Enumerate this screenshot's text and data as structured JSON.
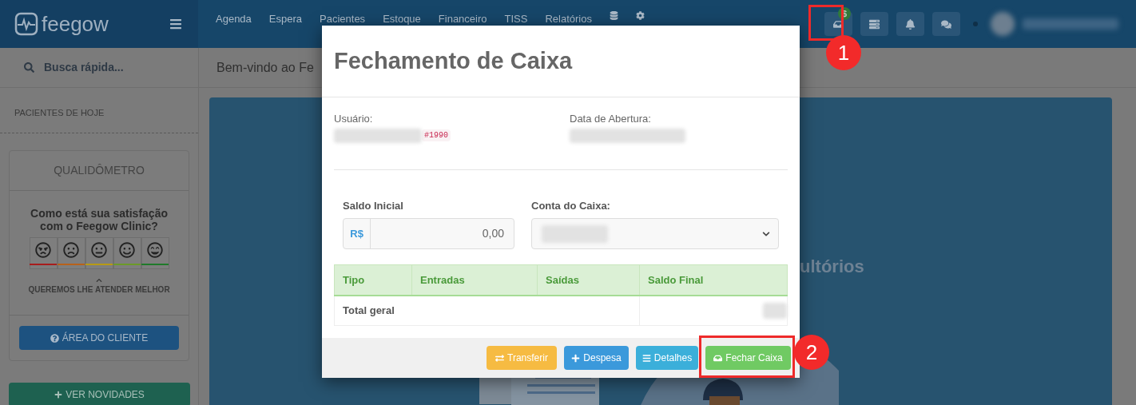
{
  "header": {
    "brand": "feegow",
    "nav": [
      "Agenda",
      "Espera",
      "Pacientes",
      "Estoque",
      "Financeiro",
      "TISS",
      "Relatórios"
    ],
    "cash_badge": "$"
  },
  "sidebar": {
    "search": "Busca rápida...",
    "section": "PACIENTES DE HOJE",
    "qualimeter": {
      "title": "QUALIDÔMETRO",
      "question": "Como está sua satisfação com o Feegow Clinic?",
      "faces": [
        {
          "kind": "angry",
          "color": "#a81c1c"
        },
        {
          "kind": "sad",
          "color": "#b8621a"
        },
        {
          "kind": "neutral",
          "color": "#b89a14"
        },
        {
          "kind": "happy",
          "color": "#6c9a28"
        },
        {
          "kind": "grin",
          "color": "#1f7a2a"
        }
      ],
      "note": "QUEREMOS LHE ATENDER MELHOR",
      "client_button": "ÁREA DO CLIENTE"
    },
    "news_button": "VER NOVIDADES"
  },
  "main": {
    "welcome": "Bem-vindo ao Fe",
    "banner_text": "ultórios"
  },
  "modal": {
    "title": "Fechamento de Caixa",
    "user_label": "Usuário:",
    "user_tag": "#1990",
    "opening_label": "Data de Abertura:",
    "initial_balance_label": "Saldo Inicial",
    "currency": "R$",
    "initial_balance": "0,00",
    "account_label": "Conta do Caixa:",
    "table": {
      "columns": [
        "Tipo",
        "Entradas",
        "Saídas",
        "Saldo Final"
      ],
      "rows": [
        {
          "label": "Total geral"
        }
      ]
    },
    "buttons": [
      {
        "kind": "transfer",
        "label": "Transferir"
      },
      {
        "kind": "expense",
        "label": "Despesa"
      },
      {
        "kind": "details",
        "label": "Detalhes"
      },
      {
        "kind": "close",
        "label": "Fechar Caixa"
      }
    ]
  },
  "annotations": [
    {
      "number": "1",
      "kind": "header"
    },
    {
      "number": "2",
      "kind": "footer"
    }
  ]
}
